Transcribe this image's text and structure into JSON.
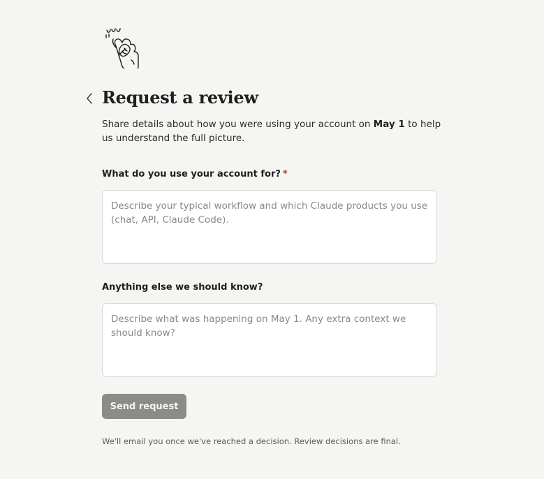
{
  "header": {
    "illustration_icon": "hand-drawn-waving-hand-icon",
    "back_icon": "chevron-left-icon",
    "title": "Request a review"
  },
  "intro": {
    "text_before": "Share details about how you were using your account on ",
    "date": "May 1",
    "text_after": " to help us understand the full picture."
  },
  "form": {
    "usage": {
      "label": "What do you use your account for?",
      "required_marker": "*",
      "placeholder": "Describe your typical workflow and which Claude products you use (chat, API, Claude Code).",
      "value": ""
    },
    "extra": {
      "label": "Anything else we should know?",
      "placeholder": "Describe what was happening on May 1. Any extra context we should know?",
      "value": ""
    },
    "submit_label": "Send request"
  },
  "footer": {
    "note": "We'll email you once we've reached a decision. Review decisions are final."
  },
  "colors": {
    "background": "#f5f5f3",
    "required": "#b53a2a",
    "button_disabled": "#8b8b87"
  }
}
